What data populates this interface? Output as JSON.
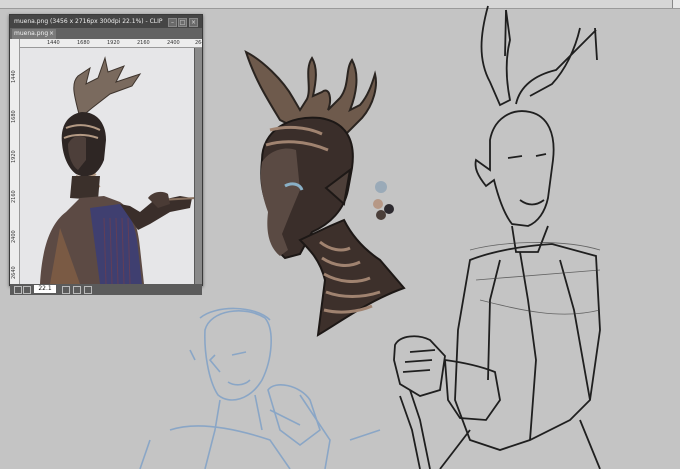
{
  "reference_window": {
    "title": "muena.png (3456 x 2716px 300dpi 22.1%) - CLIP STUDIO PAINT",
    "tab_label": "muena.png",
    "close_glyph": "×",
    "ruler_top": [
      "1440",
      "1680",
      "1920",
      "2160",
      "2400",
      "2640"
    ],
    "ruler_left": [
      "1440",
      "1680",
      "1920",
      "2160",
      "2400",
      "2640"
    ],
    "zoom": "22.1",
    "status_icons": [
      "zoom-out-icon",
      "zoom-in-icon",
      "fit-icon",
      "rotate-icon",
      "flip-icon"
    ]
  },
  "colors": {
    "canvas_bg": "#c4c4c4",
    "skin_dark": "#3a2e2a",
    "antler": "#6e5a4c",
    "sketch_blue": "#8aa6c6",
    "swatch_1": "#9aaab8",
    "swatch_2": "#b69886",
    "swatch_3": "#4b3f3a",
    "swatch_4": "#2d2a2f"
  }
}
